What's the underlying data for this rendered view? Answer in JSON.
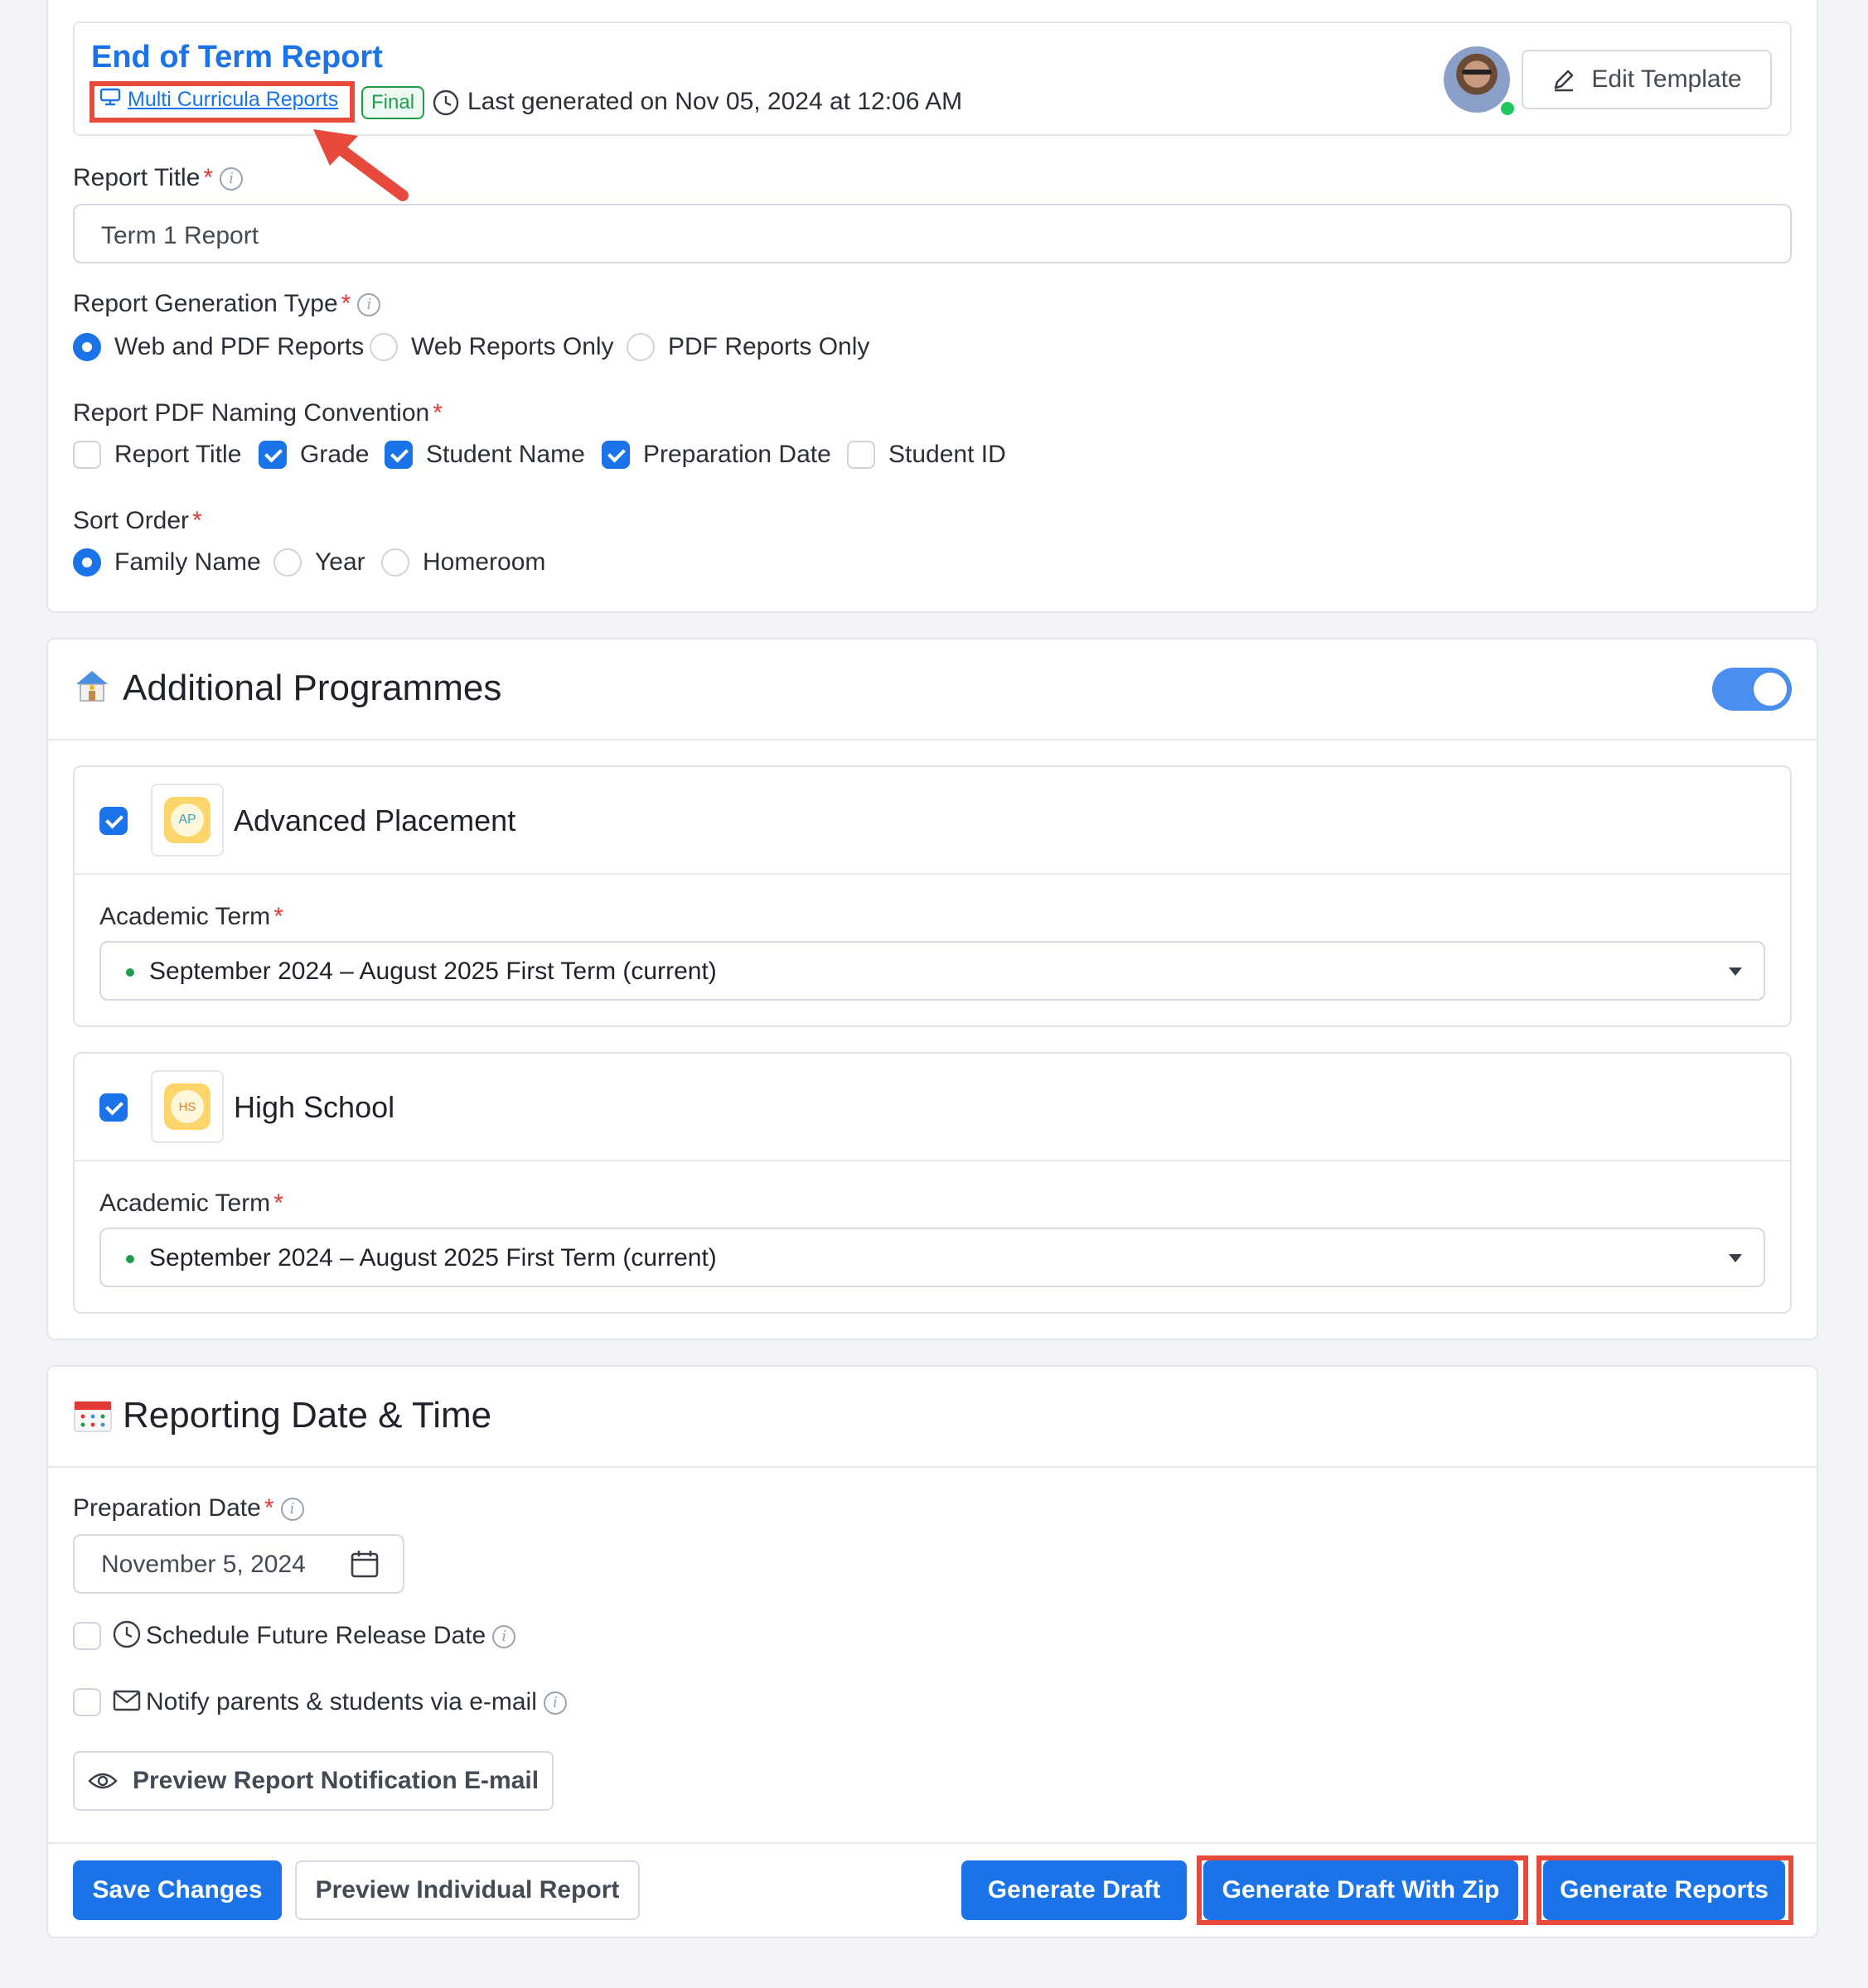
{
  "header": {
    "title": "End of Term Report",
    "curriculum_link": "Multi Curricula Reports",
    "status_badge": "Final",
    "last_generated": "Last generated on Nov 05, 2024 at 12:06 AM",
    "edit_template": "Edit Template"
  },
  "form": {
    "report_title_label": "Report Title",
    "report_title_value": "Term 1 Report",
    "generation_type_label": "Report Generation Type",
    "generation_type_options": [
      "Web and PDF Reports",
      "Web Reports Only",
      "PDF Reports Only"
    ],
    "generation_type_selected": "Web and PDF Reports",
    "naming_label": "Report PDF Naming Convention",
    "naming_options": [
      {
        "label": "Report Title",
        "checked": false
      },
      {
        "label": "Grade",
        "checked": true
      },
      {
        "label": "Student Name",
        "checked": true
      },
      {
        "label": "Preparation Date",
        "checked": true
      },
      {
        "label": "Student ID",
        "checked": false
      }
    ],
    "sort_label": "Sort Order",
    "sort_options": [
      "Family Name",
      "Year",
      "Homeroom"
    ],
    "sort_selected": "Family Name"
  },
  "programmes": {
    "title": "Additional Programmes",
    "toggle_on": true,
    "items": [
      {
        "name": "Advanced Placement",
        "abbr": "AP",
        "checked": true,
        "term_label": "Academic Term",
        "term_value": "September 2024 – August 2025 First Term (current)"
      },
      {
        "name": "High School",
        "abbr": "HS",
        "checked": true,
        "term_label": "Academic Term",
        "term_value": "September 2024 – August 2025 First Term (current)"
      }
    ]
  },
  "reporting": {
    "title": "Reporting Date & Time",
    "prep_date_label": "Preparation Date",
    "prep_date_value": "November 5, 2024",
    "schedule_label": "Schedule Future Release Date",
    "notify_label": "Notify parents & students via e-mail",
    "preview_email": "Preview Report Notification E-mail"
  },
  "footer": {
    "save": "Save Changes",
    "preview_individual": "Preview Individual Report",
    "generate_draft": "Generate Draft",
    "generate_draft_zip": "Generate Draft With Zip",
    "generate_reports": "Generate Reports"
  },
  "colors": {
    "accent": "#1a73e8",
    "highlight": "#e8493d",
    "required": "#e53935",
    "final_badge": "#1e9e4a"
  }
}
